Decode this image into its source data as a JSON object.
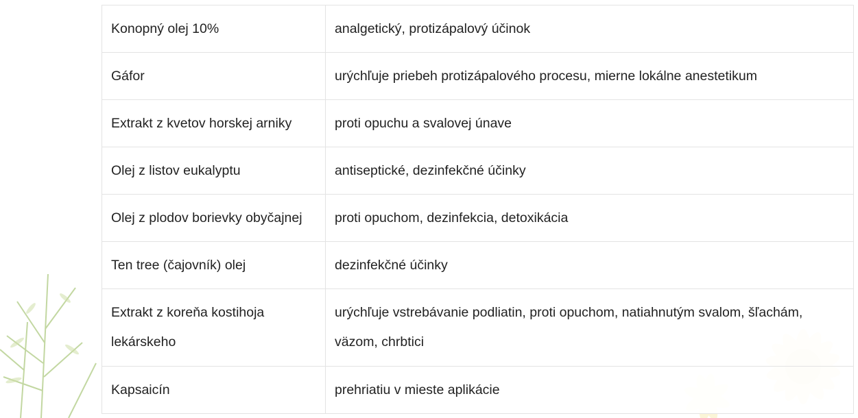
{
  "table": {
    "rows": [
      {
        "ingredient": "Konopný olej 10%",
        "effect": "analgetický, protizápalový účinok"
      },
      {
        "ingredient": "Gáfor",
        "effect": "urýchľuje priebeh protizápalového procesu, mierne lokálne anestetikum"
      },
      {
        "ingredient": "Extrakt z kvetov horskej arniky",
        "effect": "proti opuchu a svalovej únave"
      },
      {
        "ingredient": "Olej z listov eukalyptu",
        "effect": "antiseptické, dezinfekčné účinky"
      },
      {
        "ingredient": "Olej z plodov borievky obyčajnej",
        "effect": "proti opuchom, dezinfekcia, detoxikácia"
      },
      {
        "ingredient": "Ten tree (čajovník) olej",
        "effect": "dezinfekčné účinky"
      },
      {
        "ingredient": "Extrakt z koreňa kostihoja lekárskeho",
        "effect": "urýchľuje vstrebávanie podliatin, proti opuchom, natiahnutým svalom, šľachám, väzom, chrbtici"
      },
      {
        "ingredient": "Kapsaicín",
        "effect": "prehriatiu v mieste aplikácie"
      }
    ]
  },
  "decorations": {
    "left": "plant-leaves-image",
    "right": "arnica-flower-image"
  },
  "colors": {
    "border": "#e3e3e3",
    "text": "#222222",
    "leaf": "#9fbf6a",
    "petal": "#f3e08a"
  }
}
